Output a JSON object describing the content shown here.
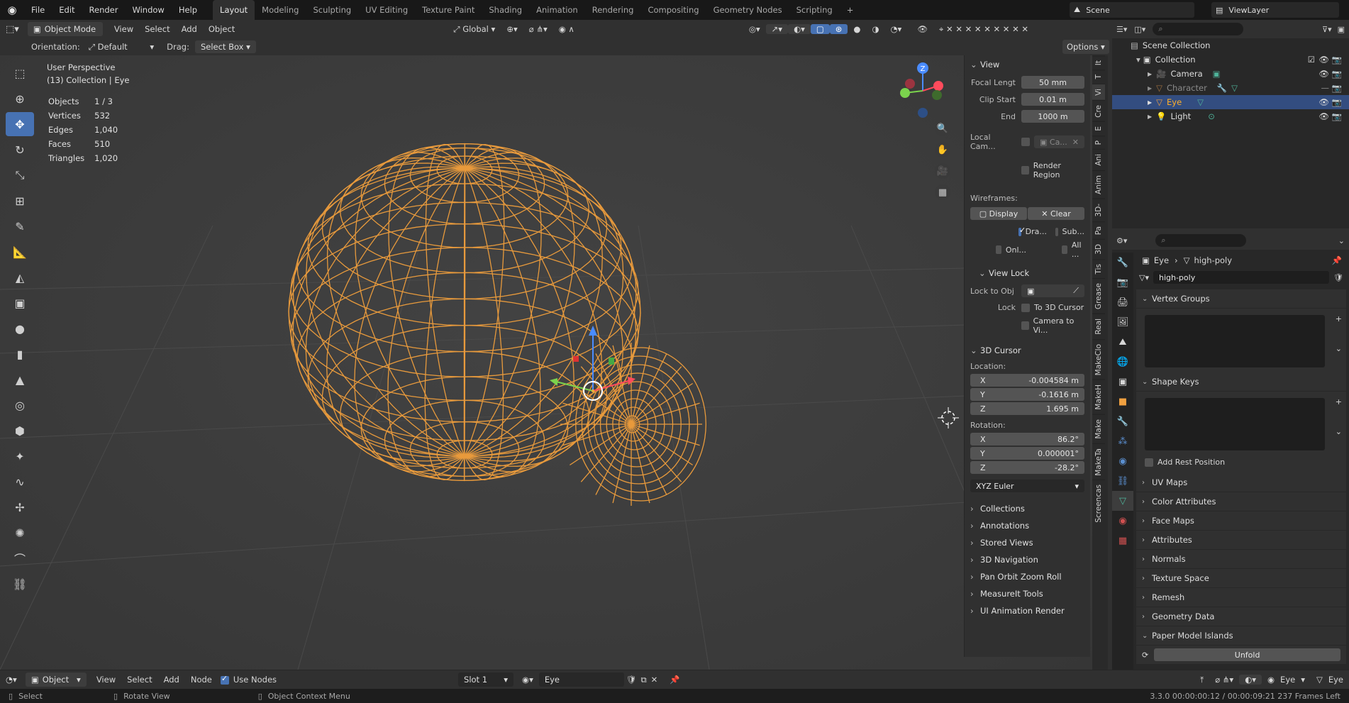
{
  "topbar": {
    "menus": [
      "File",
      "Edit",
      "Render",
      "Window",
      "Help"
    ],
    "workspaces": [
      "Layout",
      "Modeling",
      "Sculpting",
      "UV Editing",
      "Texture Paint",
      "Shading",
      "Animation",
      "Rendering",
      "Compositing",
      "Geometry Nodes",
      "Scripting"
    ],
    "active_workspace": "Layout",
    "add_tab": "+",
    "scene": "Scene",
    "view_layer": "ViewLayer"
  },
  "header": {
    "mode": "Object Mode",
    "menus": [
      "View",
      "Select",
      "Add",
      "Object"
    ],
    "transform_orientation": "Global",
    "orientation_label": "Orientation:",
    "orientation_value": "Default",
    "drag_label": "Drag:",
    "drag_value": "Select Box",
    "options": "Options"
  },
  "viewport": {
    "perspective": "User Perspective",
    "collection_info": "(13) Collection | Eye",
    "stats": [
      {
        "label": "Objects",
        "value": "1 / 3"
      },
      {
        "label": "Vertices",
        "value": "532"
      },
      {
        "label": "Edges",
        "value": "1,040"
      },
      {
        "label": "Faces",
        "value": "510"
      },
      {
        "label": "Triangles",
        "value": "1,020"
      }
    ],
    "wire_color": "#e89a3c",
    "gizmo_axes": {
      "z": "Z"
    }
  },
  "npanel": {
    "view_title": "View",
    "focal_label": "Focal Lengt",
    "focal_value": "50 mm",
    "clip_start_label": "Clip Start",
    "clip_start_value": "0.01 m",
    "end_label": "End",
    "end_value": "1000 m",
    "local_cam_label": "Local Cam...",
    "local_cam_value": "Ca...",
    "render_region": "Render Region",
    "wireframes_label": "Wireframes:",
    "display": "Display",
    "clear": "Clear",
    "dra": "Dra...",
    "sub": "Sub...",
    "onl": "Onl...",
    "all": "All ...",
    "view_lock_title": "View Lock",
    "lock_to_obj": "Lock to Obj",
    "lock_label": "Lock",
    "to_3d_cursor": "To 3D Cursor",
    "camera_to_vi": "Camera to Vi...",
    "cursor_title": "3D Cursor",
    "location_label": "Location:",
    "loc": [
      {
        "axis": "X",
        "value": "-0.004584 m"
      },
      {
        "axis": "Y",
        "value": "-0.1616 m"
      },
      {
        "axis": "Z",
        "value": "1.695 m"
      }
    ],
    "rotation_label": "Rotation:",
    "rot": [
      {
        "axis": "X",
        "value": "86.2°"
      },
      {
        "axis": "Y",
        "value": "0.000001°"
      },
      {
        "axis": "Z",
        "value": "-28.2°"
      }
    ],
    "rotation_mode": "XYZ Euler",
    "collapsed": [
      "Collections",
      "Annotations",
      "Stored Views",
      "3D Navigation",
      "Pan Orbit Zoom Roll",
      "MeasureIt Tools",
      "UI Animation Render"
    ]
  },
  "side_tabs": [
    "It",
    "T",
    "Vi",
    "Cre",
    "E",
    "P",
    "Ani",
    "Anim",
    "3D-",
    "Pa",
    "3D",
    "Tis",
    "Grease",
    "Real",
    "MakeClo",
    "MakeH",
    "Make",
    "MakeTa",
    "Screencas"
  ],
  "active_side_tab": "Vi",
  "outliner": {
    "scene_collection": "Scene Collection",
    "collection": "Collection",
    "items": [
      {
        "name": "Camera",
        "selected": false
      },
      {
        "name": "Character",
        "selected": false
      },
      {
        "name": "Eye",
        "selected": true
      },
      {
        "name": "Light",
        "selected": false
      }
    ]
  },
  "properties": {
    "object": "Eye",
    "data": "high-poly",
    "mesh_name": "high-poly",
    "vertex_groups": "Vertex Groups",
    "shape_keys": "Shape Keys",
    "add_rest_position": "Add Rest Position",
    "collapsed": [
      "UV Maps",
      "Color Attributes",
      "Face Maps",
      "Attributes",
      "Normals",
      "Texture Space",
      "Remesh",
      "Geometry Data"
    ],
    "paper_model": "Paper Model Islands",
    "unfold": "Unfold"
  },
  "footer": {
    "editor": "Object",
    "menus": [
      "View",
      "Select",
      "Add",
      "Node"
    ],
    "use_nodes": "Use Nodes",
    "slot": "Slot 1",
    "material": "Eye",
    "right_obj": "Eye",
    "right_data": "Eye"
  },
  "status": {
    "select": "Select",
    "rotate": "Rotate View",
    "context": "Object Context Menu",
    "info": "3.3.0  00:00:00:12 / 00:00:09:21  237 Frames Left"
  }
}
